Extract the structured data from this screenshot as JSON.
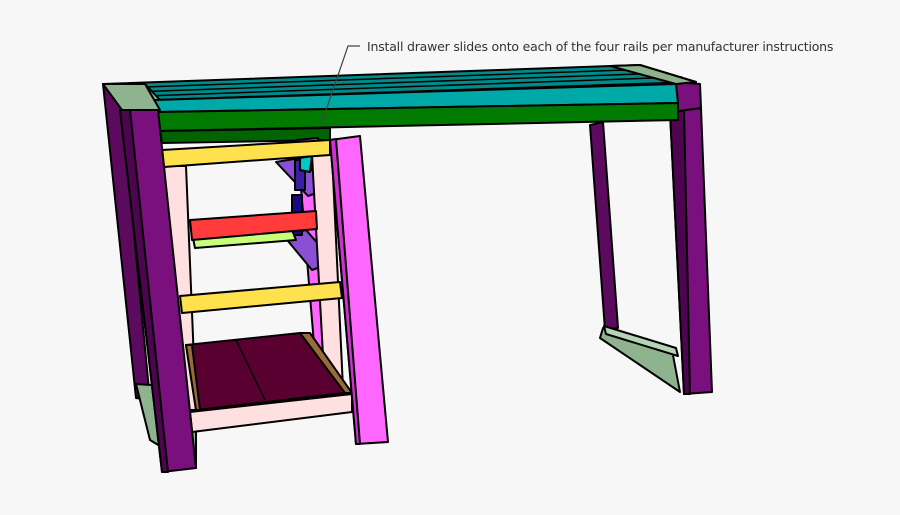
{
  "annotation": {
    "text": "Install drawer slides onto each of the four rails per manufacturer instructions"
  },
  "colors": {
    "leg": "#7a0f7e",
    "frame_light": "#8fb38f",
    "top_slats": "#008b8b",
    "apron": "#007a00",
    "rail_yellow": "#ffe14d",
    "rail_red": "#ff3b3b",
    "rail_lime": "#c8ff78",
    "side_pink": "#ffe0e0",
    "front_leg_pink": "#ff66ff",
    "slide_purple": "#8a4fd4",
    "shelf": "#5a0030",
    "shelf_edge": "#9a6b3a"
  }
}
